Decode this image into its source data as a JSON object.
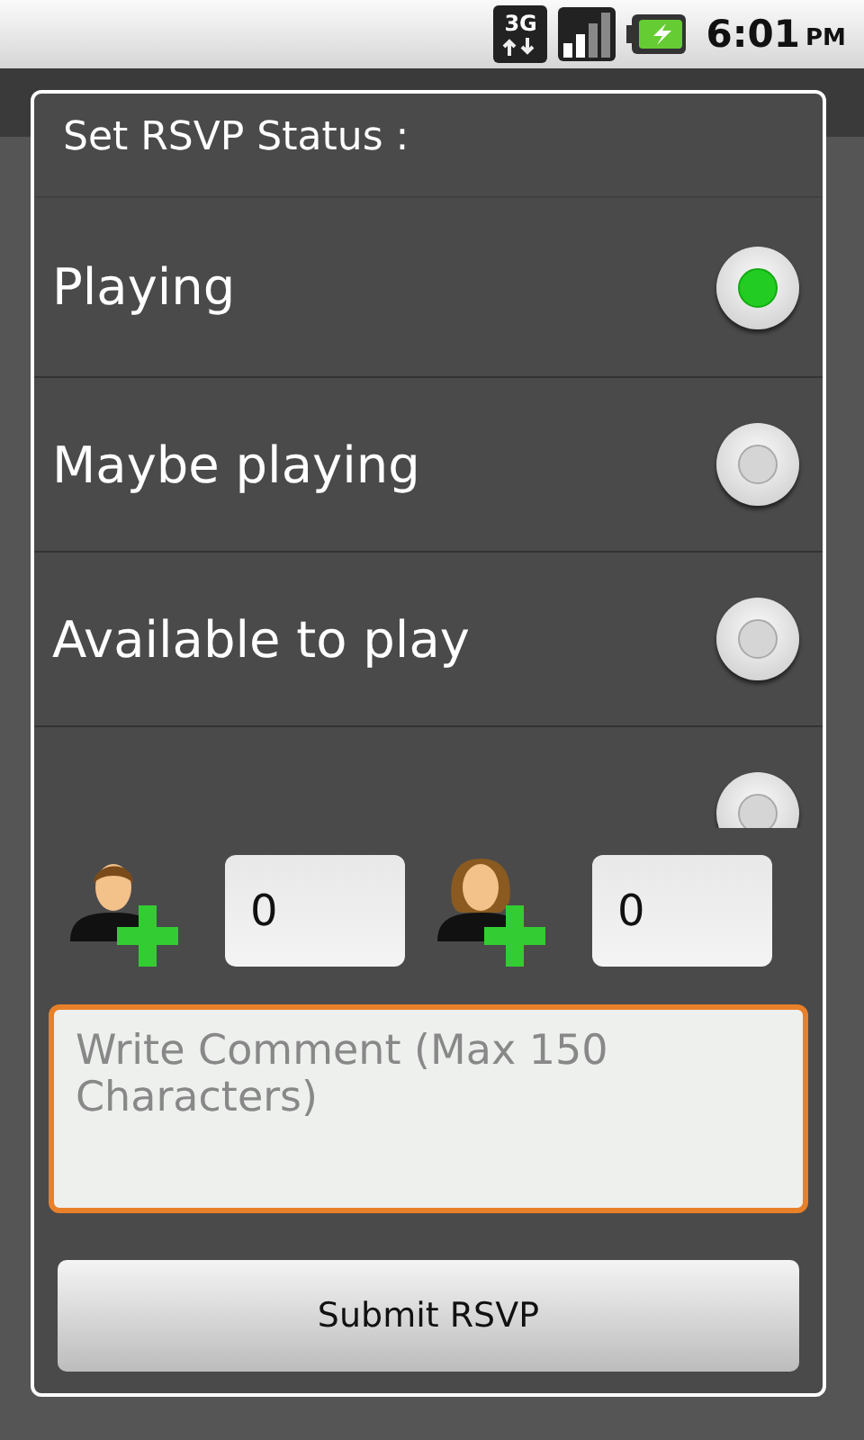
{
  "status_bar": {
    "network": "3G",
    "time": "6:01",
    "meridiem": "PM"
  },
  "dialog": {
    "title": "Set RSVP Status :",
    "options": [
      {
        "label": "Playing",
        "selected": true
      },
      {
        "label": "Maybe playing",
        "selected": false
      },
      {
        "label": "Available to play",
        "selected": false
      },
      {
        "selected": false
      }
    ],
    "counters": [
      {
        "kind": "male",
        "value": "0"
      },
      {
        "kind": "female",
        "value": "0"
      }
    ],
    "comment": {
      "placeholder": "Write Comment (Max 150 Characters)",
      "focused": true
    },
    "submit": "Submit RSVP"
  }
}
